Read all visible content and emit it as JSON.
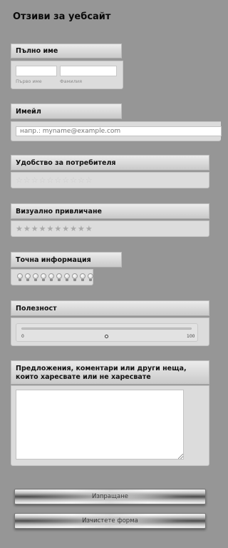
{
  "form": {
    "title": "Отзиви за уебсайт"
  },
  "full_name": {
    "label": "Пълно име",
    "first_value": "",
    "last_value": "",
    "first_sublabel": "Първо име",
    "last_sublabel": "Фамилия"
  },
  "email": {
    "label": "Имейл",
    "placeholder": "напр.: myname@example.com"
  },
  "usability": {
    "label": "Удобство за потребителя",
    "scale_max": 10,
    "rating": 0,
    "icon": "star-outline-icon"
  },
  "visual_appeal": {
    "label": "Визуално привличане",
    "scale_max": 10,
    "rating": 0,
    "icon": "star-filled-icon"
  },
  "accurate_info": {
    "label": "Точна информация",
    "scale_max": 10,
    "rating": 0,
    "icon": "lightbulb-icon"
  },
  "usefulness": {
    "label": "Полезност",
    "min_label": "0",
    "max_label": "100",
    "value": 50
  },
  "suggestions": {
    "label": "Предложения, коментари или други неща, които харесвате или не харесвате",
    "value": ""
  },
  "buttons": {
    "submit_label": "Изпращане",
    "clear_label": "Изчистете форма"
  },
  "colors": {
    "page_background": "#969696",
    "section_header": "#d6d6d6",
    "section_body": "#dcdcdc"
  }
}
